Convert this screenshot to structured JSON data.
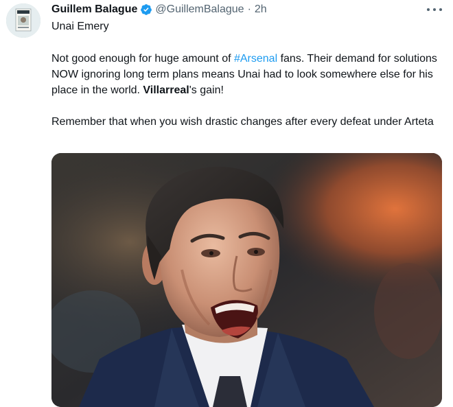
{
  "tweet": {
    "author_name": "Guillem Balague",
    "handle": "@GuillemBalague",
    "separator": "·",
    "time": "2h",
    "subject": "Unai Emery",
    "line1_pre": "Not good enough for huge amount of ",
    "hashtag": "#Arsenal",
    "line1_post": " fans. Their demand for solutions NOW ignoring long term plans means Unai had to look somewhere else for his place in the world. ",
    "mention_bold": "Villarreal",
    "line1_end": "'s gain!",
    "line2": "Remember that when you wish drastic changes after every defeat under Arteta"
  },
  "icons": {
    "verified": "verified-badge-icon",
    "more": "more-options-icon"
  },
  "colors": {
    "link": "#1d9bf0",
    "secondary_text": "#536471",
    "verified": "#1d9bf0"
  }
}
